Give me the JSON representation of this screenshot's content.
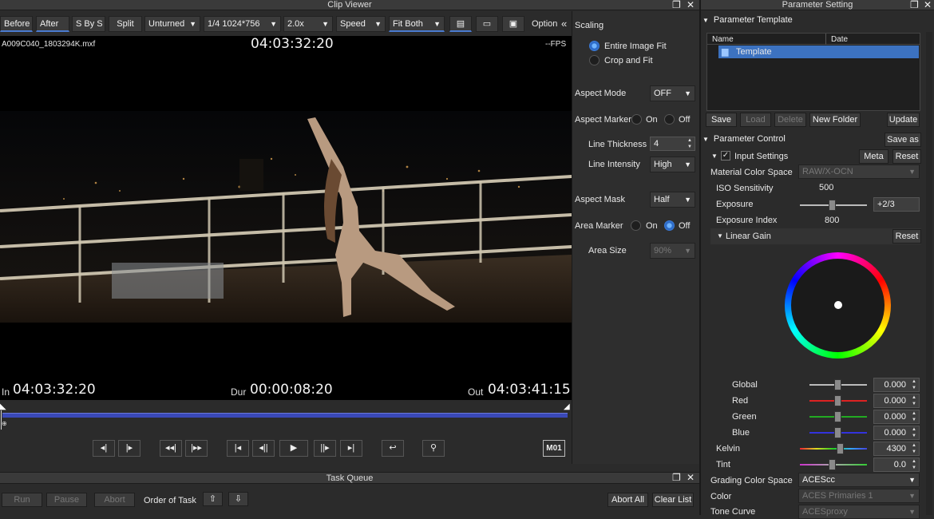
{
  "clip_viewer": {
    "title": "Clip Viewer",
    "toolbar": {
      "before": "Before",
      "after": "After",
      "sbys": "S By S",
      "split": "Split",
      "untur": "Unturned",
      "res": "1/4 1024*756",
      "zoom": "2.0x",
      "speed": "Speed",
      "fit": "Fit Both",
      "option": "Option"
    },
    "filename": "A009C040_1803294K.mxf",
    "timecode": "04:03:32:20",
    "fps": "--FPS",
    "in_label": "In",
    "in_tc": "04:03:32:20",
    "dur_label": "Dur",
    "dur_tc": "00:00:08:20",
    "out_label": "Out",
    "out_tc": "04:03:41:15",
    "m01": "M01"
  },
  "scaling": {
    "title": "Scaling",
    "entire_fit": "Entire Image Fit",
    "crop_fit": "Crop and Fit",
    "aspect_mode_label": "Aspect Mode",
    "aspect_mode": "OFF",
    "aspect_marker_label": "Aspect Marker",
    "on": "On",
    "off": "Off",
    "line_thickness_label": "Line Thickness",
    "line_thickness": "4",
    "line_intensity_label": "Line Intensity",
    "line_intensity": "High",
    "aspect_mask_label": "Aspect Mask",
    "aspect_mask": "Half",
    "area_marker_label": "Area Marker",
    "area_size_label": "Area Size",
    "area_size": "90%"
  },
  "task_queue": {
    "title": "Task Queue",
    "run": "Run",
    "pause": "Pause",
    "abort": "Abort",
    "order": "Order of Task",
    "abort_all": "Abort All",
    "clear": "Clear List"
  },
  "param": {
    "title": "Parameter Setting",
    "template_header": "Parameter Template",
    "col_name": "Name",
    "col_date": "Date",
    "template_item": "Template",
    "save": "Save",
    "load": "Load",
    "delete": "Delete",
    "new_folder": "New Folder",
    "update": "Update",
    "control_header": "Parameter Control",
    "save_as": "Save as",
    "input_settings": "Input Settings",
    "meta": "Meta",
    "reset": "Reset",
    "mcs_label": "Material Color Space",
    "mcs": "RAW/X-OCN",
    "iso_label": "ISO Sensitivity",
    "iso": "500",
    "exposure_label": "Exposure",
    "exposure": "+2/3",
    "ei_label": "Exposure Index",
    "ei": "800",
    "linear_gain": "Linear Gain",
    "global_label": "Global",
    "red_label": "Red",
    "green_label": "Green",
    "blue_label": "Blue",
    "global": "0.000",
    "red": "0.000",
    "green": "0.000",
    "blue": "0.000",
    "kelvin_label": "Kelvin",
    "kelvin": "4300",
    "tint_label": "Tint",
    "tint": "0.0",
    "gcs_label": "Grading Color Space",
    "gcs": "ACEScc",
    "color_label": "Color",
    "color": "ACES Primaries 1",
    "tone_label": "Tone Curve",
    "tone": "ACESproxy"
  }
}
